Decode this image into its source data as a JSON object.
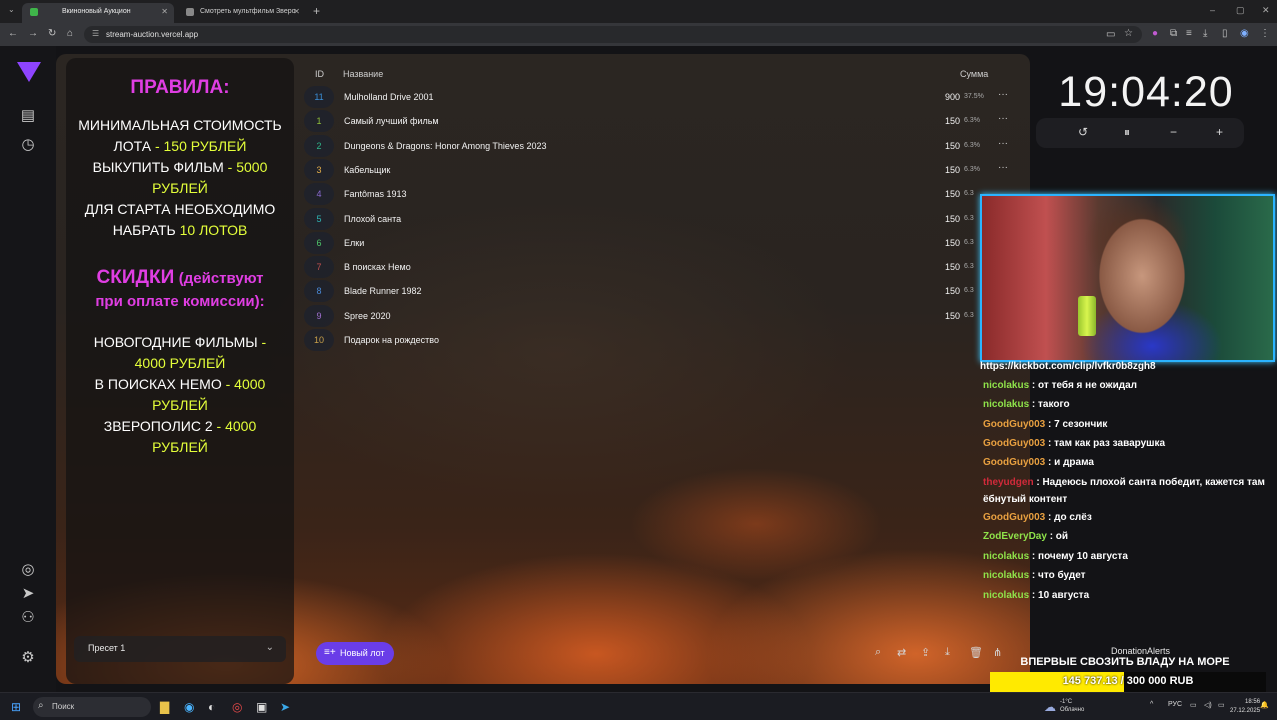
{
  "browser": {
    "tabs": [
      {
        "title": "Вкиноновый Аукцион",
        "active": true
      },
      {
        "title": "Смотреть мультфильм Зверо",
        "active": false
      }
    ],
    "url": "stream-auction.vercel.app"
  },
  "rules": {
    "title": "ПРАВИЛА:",
    "lines": [
      {
        "a": "МИНИМАЛЬНАЯ СТОИМОСТЬ",
        "b": ""
      },
      {
        "a": "ЛОТА ",
        "b": "- 150 РУБЛЕЙ"
      },
      {
        "a": "ВЫКУПИТЬ ФИЛЬМ ",
        "b": "- 5000"
      },
      {
        "a": "",
        "b": "РУБЛЕЙ"
      },
      {
        "a": "ДЛЯ СТАРТА НЕОБХОДИМО",
        "b": ""
      },
      {
        "a": "НАБРАТЬ ",
        "b": "10 ЛОТОВ"
      }
    ],
    "discount_title": "СКИДКИ",
    "discount_note": "(действуют",
    "discount_note2": "при оплате комиссии):",
    "discounts": [
      {
        "a": "НОВОГОДНИЕ ФИЛЬМЫ ",
        "b": "-"
      },
      {
        "a": "",
        "b": "4000 РУБЛЕЙ"
      },
      {
        "a": "В ПОИСКАХ НЕМО ",
        "b": "- 4000"
      },
      {
        "a": "",
        "b": "РУБЛЕЙ"
      },
      {
        "a": "ЗВЕРОПОЛИС 2 ",
        "b": "- 4000"
      },
      {
        "a": "",
        "b": "РУБЛЕЙ"
      }
    ],
    "preset": "Пресет 1"
  },
  "table": {
    "col_id": "ID",
    "col_name": "Название",
    "col_sum": "Сумма",
    "rows": [
      {
        "id": "11",
        "name": "Mulholland Drive 2001",
        "amount": "900",
        "pct": "37.5%",
        "color": "#3a8fd9"
      },
      {
        "id": "1",
        "name": "Самый лучший фильм",
        "amount": "150",
        "pct": "6.3%",
        "color": "#8fbf3a"
      },
      {
        "id": "2",
        "name": "Dungeons & Dragons: Honor Among Thieves 2023",
        "amount": "150",
        "pct": "6.3%",
        "color": "#2fb58a"
      },
      {
        "id": "3",
        "name": "Кабельщик",
        "amount": "150",
        "pct": "6.3%",
        "color": "#e6b04a"
      },
      {
        "id": "4",
        "name": "Fantômas 1913",
        "amount": "150",
        "pct": "6.3",
        "color": "#8a6ad0"
      },
      {
        "id": "5",
        "name": "Плохой санта",
        "amount": "150",
        "pct": "6.3",
        "color": "#2fb5b5"
      },
      {
        "id": "6",
        "name": "Елки",
        "amount": "150",
        "pct": "6.3",
        "color": "#4fc76a"
      },
      {
        "id": "7",
        "name": "В поисках Немо",
        "amount": "150",
        "pct": "6.3",
        "color": "#c0504f"
      },
      {
        "id": "8",
        "name": "Blade Runner 1982",
        "amount": "150",
        "pct": "6.3",
        "color": "#4a8ad9"
      },
      {
        "id": "9",
        "name": "Spree 2020",
        "amount": "150",
        "pct": "6.3",
        "color": "#a070d0"
      },
      {
        "id": "10",
        "name": "Подарок на рождество",
        "amount": "",
        "pct": "",
        "color": "#c9a04a"
      }
    ]
  },
  "timer": {
    "value": "19:04:20"
  },
  "chat": [
    {
      "user": "",
      "text": "https://kickbot.com/clip/lvfkr0b8zgh8",
      "color": "#ffffff"
    },
    {
      "user": "nicolakus",
      "text": ": от тебя я не ожидал",
      "color": "#8fe34a"
    },
    {
      "user": "nicolakus",
      "text": ": такого",
      "color": "#8fe34a"
    },
    {
      "user": "GoodGuy003",
      "text": ": 7 сезончик",
      "color": "#e8a040"
    },
    {
      "user": "GoodGuy003",
      "text": ": там как раз заварушка",
      "color": "#e8a040"
    },
    {
      "user": "GoodGuy003",
      "text": ": и драма",
      "color": "#e8a040"
    },
    {
      "user": "theyudgen",
      "text": ": Надеюсь плохой санта победит, кажется там ёбнутый контент",
      "color": "#d02a3a"
    },
    {
      "user": "GoodGuy003",
      "text": ": до слёз",
      "color": "#e8a040"
    },
    {
      "user": "ZodEveryDay",
      "text": ": ой",
      "color": "#8fe34a"
    },
    {
      "user": "nicolakus",
      "text": ": почему 10 августа",
      "color": "#8fe34a"
    },
    {
      "user": "nicolakus",
      "text": ": что будет",
      "color": "#8fe34a"
    },
    {
      "user": "nicolakus",
      "text": ": 10 августа",
      "color": "#8fe34a"
    }
  ],
  "goal": {
    "brand": "DonationAlerts",
    "title": "ВПЕРВЫЕ СВОЗИТЬ ВЛАДУ НА МОРЕ",
    "progress_text": "145 737.13 / 300 000 RUB",
    "progress_fraction": 0.4858
  },
  "actions": {
    "new_lot": "Новый лот"
  },
  "taskbar": {
    "search": "Поиск",
    "temp": "-1°C",
    "weather": "Облачно",
    "lang": "РУС",
    "time": "18:56",
    "date": "27.12.2025"
  },
  "colors": {
    "accent": "#6a3de8",
    "rules_pink": "#e03ee3",
    "rules_yellow": "#e4ff3a"
  }
}
